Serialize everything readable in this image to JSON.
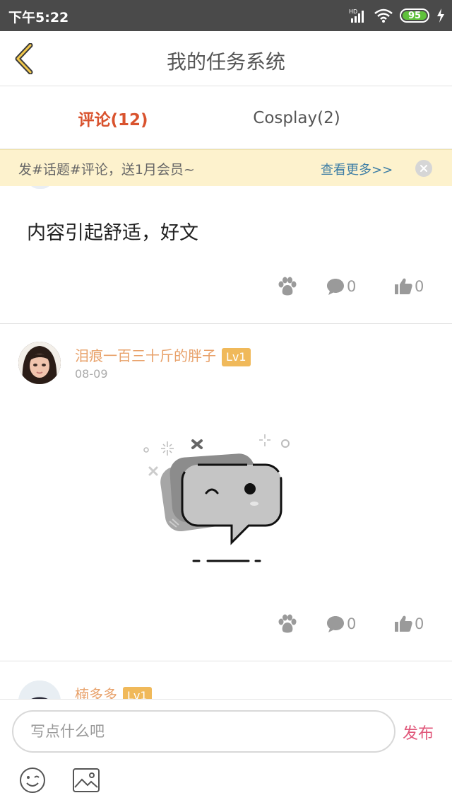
{
  "status_bar": {
    "time": "下午5:22",
    "battery": "95",
    "signal_label": "HD"
  },
  "nav": {
    "title": "我的任务系统"
  },
  "tabs": [
    {
      "label": "评论(12)",
      "active": true
    },
    {
      "label": "Cosplay(2)",
      "active": false
    }
  ],
  "promo": {
    "text": "发#话题#评论，送1月会员~",
    "link": "查看更多>>"
  },
  "posts": [
    {
      "text": "内容引起舒适，好文",
      "comments": "0",
      "likes": "0"
    },
    {
      "username": "泪痕一百三十斤的胖子",
      "level": "Lv1",
      "date": "08-09",
      "comments": "0",
      "likes": "0"
    },
    {
      "username": "楠多多",
      "level": "Lv1"
    }
  ],
  "composer": {
    "placeholder": "写点什么吧",
    "publish_label": "发布"
  },
  "colors": {
    "accent": "#d9532e",
    "publish": "#e0577a",
    "link": "#3e7ea5",
    "username": "#e8a16a",
    "level_badge": "#f0b95a"
  },
  "icons": [
    "back-arrow-icon",
    "wifi-icon",
    "signal-icon",
    "battery-icon",
    "paw-icon",
    "comment-icon",
    "thumbs-up-icon",
    "close-icon",
    "emoji-icon",
    "image-icon"
  ]
}
